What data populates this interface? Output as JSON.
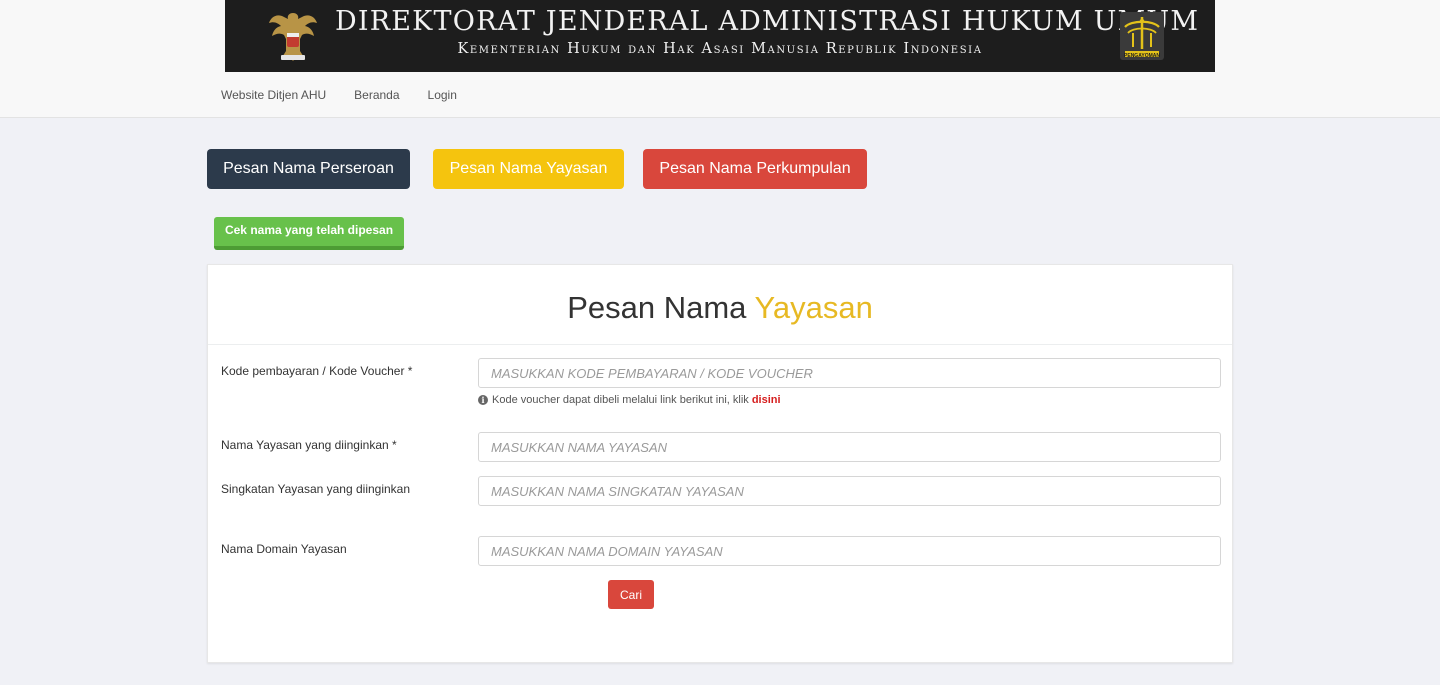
{
  "header": {
    "banner_title": "DIREKTORAT JENDERAL ADMINISTRASI HUKUM UMUM",
    "banner_subtitle": "Kementerian Hukum dan Hak Asasi Manusia Republik Indonesia",
    "right_emblem_caption": "PENGAYOMAN",
    "emblem_left_icon": "garuda-emblem-icon",
    "emblem_right_icon": "pengayoman-emblem-icon"
  },
  "nav": {
    "items": [
      {
        "label": "Website Ditjen AHU"
      },
      {
        "label": "Beranda"
      },
      {
        "label": "Login"
      }
    ]
  },
  "actions": {
    "perseroan_label": "Pesan Nama Perseroan",
    "yayasan_label": "Pesan Nama Yayasan",
    "perkumpulan_label": "Pesan Nama Perkumpulan",
    "cek_label": "Cek nama yang telah dipesan"
  },
  "form": {
    "title_prefix": "Pesan Nama",
    "title_accent": "Yayasan",
    "fields": [
      {
        "label": "Kode pembayaran / Kode Voucher *",
        "placeholder": "MASUKKAN KODE PEMBAYARAN / KODE VOUCHER",
        "value": ""
      },
      {
        "label": "Nama Yayasan yang diinginkan *",
        "placeholder": "MASUKKAN NAMA YAYASAN",
        "value": ""
      },
      {
        "label": "Singkatan Yayasan yang diinginkan",
        "placeholder": "MASUKKAN NAMA SINGKATAN YAYASAN",
        "value": ""
      },
      {
        "label": "Nama Domain Yayasan",
        "placeholder": "MASUKKAN NAMA DOMAIN YAYASAN",
        "value": ""
      }
    ],
    "hint_text": "Kode voucher dapat dibeli melalui link berikut ini, klik",
    "hint_link": "disini",
    "submit_label": "Cari"
  },
  "colors": {
    "perseroan": "#2c3a4b",
    "yayasan": "#f5c40e",
    "perkumpulan": "#d9473c",
    "cek": "#68c14b",
    "title_accent": "#e7b923",
    "link": "#d61e1e"
  }
}
